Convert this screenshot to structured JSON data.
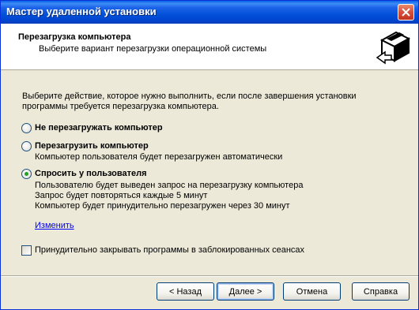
{
  "window": {
    "title": "Мастер удаленной установки"
  },
  "header": {
    "title": "Перезагрузка компьютера",
    "subtitle": "Выберите вариант перезагрузки операционной системы",
    "icon": "computer-box-icon"
  },
  "content": {
    "intro": "Выберите действие, которое нужно выполнить, если после завершения установки программы требуется перезагрузка компьютера.",
    "options": [
      {
        "label": "Не перезагружать компьютер",
        "checked": false,
        "description": []
      },
      {
        "label": "Перезагрузить компьютер",
        "checked": false,
        "description": [
          "Компьютер пользователя будет перезагружен автоматически"
        ]
      },
      {
        "label": "Спросить у пользователя",
        "checked": true,
        "description": [
          "Пользователю будет выведен запрос на перезагрузку компьютера",
          "Запрос будет повторяться каждые 5 минут",
          "Компьютер будет принудительно перезагружен через 30 минут"
        ]
      }
    ],
    "change_link": "Изменить",
    "force_close_label": "Принудительно закрывать программы в заблокированных сеансах",
    "force_close_checked": false
  },
  "buttons": {
    "back": "< Назад",
    "next": "Далее >",
    "cancel": "Отмена",
    "help": "Справка"
  },
  "colors": {
    "titlebar": "#0054e3",
    "dialog_bg": "#ece9d8",
    "link": "#0000ff",
    "radio_dot": "#21a121"
  }
}
